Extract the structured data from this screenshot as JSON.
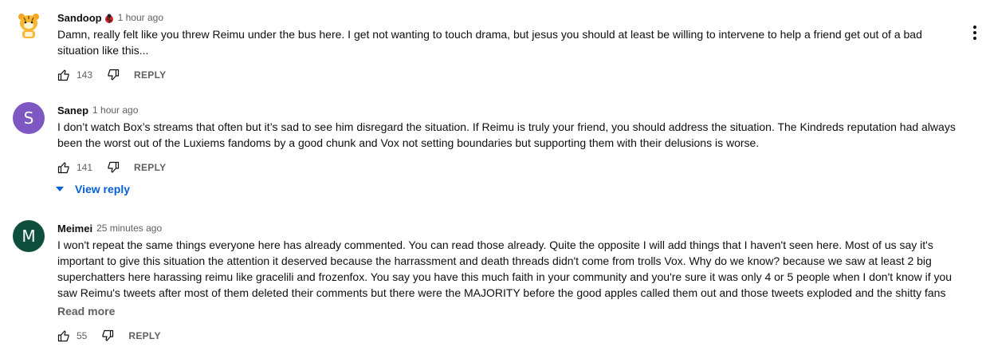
{
  "colors": {
    "avatar_s": "#7e57c2",
    "avatar_m": "#1b5e20",
    "link": "#065fd4",
    "meta": "#606060"
  },
  "comments": [
    {
      "author": "Sandoop",
      "badge_icon": "ladybug-emoji-icon",
      "time": "1 hour ago",
      "text": "Damn, really felt like you threw Reimu under the bus here. I get not wanting to touch drama, but jesus you should at least be willing to intervene to help a friend get out of a bad situation like this...",
      "likes": "143",
      "reply_label": "REPLY",
      "avatar_icon": "tiger-avatar-icon"
    },
    {
      "author": "Sanep",
      "time": "1 hour ago",
      "avatar_letter": "S",
      "text": "I don’t watch Box’s streams that often but it’s sad to see him disregard the situation. If Reimu is truly your friend, you should address the situation. The Kindreds reputation had always been the worst out of the Luxiems fandoms by a good chunk and Vox not setting boundaries but supporting them with their delusions is worse.",
      "likes": "141",
      "reply_label": "REPLY",
      "view_reply": "View reply"
    },
    {
      "author": "Meimei",
      "time": "25 minutes ago",
      "avatar_letter": "M",
      "text": "I won't repeat the same things everyone here has already commented. You can read those already. Quite the opposite I will add things that I haven't seen here. Most of us say it's important to give this situation the attention it deserved because the harrassment and death threads didn't come from trolls Vox. Why do we know? because we saw at least 2 big superchatters here harassing reimu like gracelili and frozenfox. You say you have this much faith in your community and you're sure it was only 4 or 5 people when I don't know if you saw Reimu's tweets after most of them deleted their comments but there were the MAJORITY before the good apples called them out and those tweets exploded and the shitty fans …",
      "read_more": "Read more",
      "likes": "55",
      "reply_label": "REPLY"
    }
  ]
}
